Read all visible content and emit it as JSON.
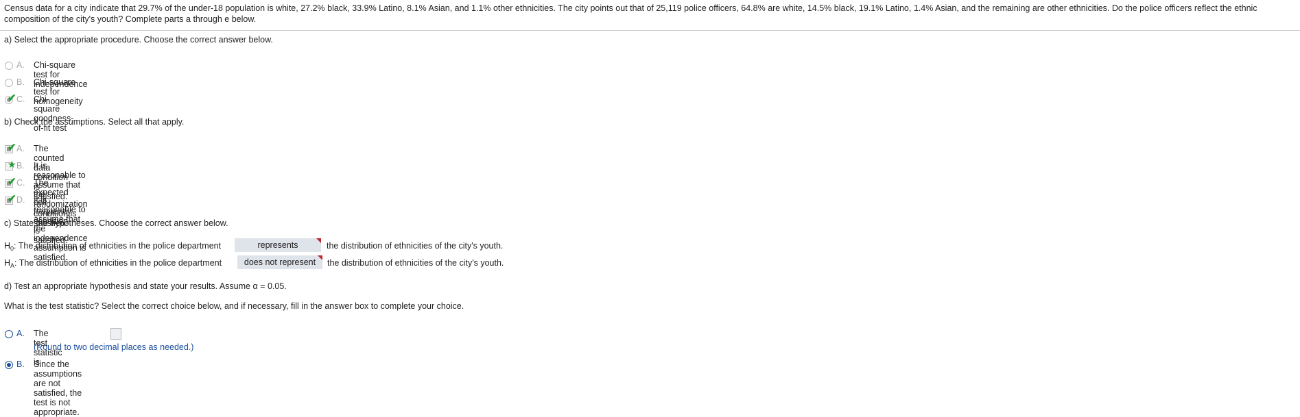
{
  "problem": {
    "intro": "Census data for a city indicate that 29.7% of the under-18 population is white, 27.2% black, 33.9% Latino, 8.1% Asian, and 1.1% other ethnicities. The city points out that of 25,119 police officers, 64.8% are white, 14.5% black, 19.1% Latino, 1.4% Asian, and the remaining are other ethnicities. Do the police officers reflect the ethnic composition of the city's youth? Complete parts a through e below."
  },
  "part_a": {
    "question": "a) Select the appropriate procedure. Choose the correct answer below.",
    "options": [
      {
        "letter": "A.",
        "text": "Chi-square test for independence"
      },
      {
        "letter": "B.",
        "text": "Chi-square test for homogeneity"
      },
      {
        "letter": "C.",
        "text": "Chi-square goodness-of-fit test"
      }
    ]
  },
  "part_b": {
    "question": "b) Check the assumptions. Select all that apply.",
    "options": [
      {
        "letter": "A.",
        "text": "The counted data condition is satisfied."
      },
      {
        "letter": "B.",
        "text": "It is reasonable to assume that the randomization condition is satisfied."
      },
      {
        "letter": "C.",
        "text": "The expected cell frequency condition is satisfied."
      },
      {
        "letter": "D.",
        "text": "It is reasonable to assume that the independence assumption is satisfied."
      }
    ]
  },
  "part_c": {
    "question": "c) State the hypotheses. Choose the correct answer below.",
    "h0": {
      "symbol": "H",
      "sub": "0",
      "prefix": ": The distribution of ethnicities in the police department",
      "choice": "represents",
      "suffix": "the distribution of ethnicities of the city's youth."
    },
    "ha": {
      "symbol": "H",
      "sub": "A",
      "prefix": ": The distribution of ethnicities in the police department",
      "choice": "does not represent",
      "suffix": "the distribution of ethnicities of the city's youth."
    }
  },
  "part_d": {
    "question": "d) Test an appropriate hypothesis and state your results. Assume α = 0.05.",
    "subquestion": "What is the test statistic? Select the correct choice below, and if necessary, fill in the answer box to complete your choice.",
    "options": [
      {
        "letter": "A.",
        "text": "The test statistic is",
        "hint": "(Round to two decimal places as needed.)"
      },
      {
        "letter": "B.",
        "text": "Since the assumptions are not satisfied, the test is not appropriate."
      }
    ]
  },
  "colors": {
    "accent": "#1a4f9c",
    "correct": "#1e9e2e",
    "flag": "#c0262d",
    "dropdown_bg": "#dfe3ea"
  },
  "icons": {
    "correct": "check-mark-icon",
    "partial": "star-icon"
  }
}
